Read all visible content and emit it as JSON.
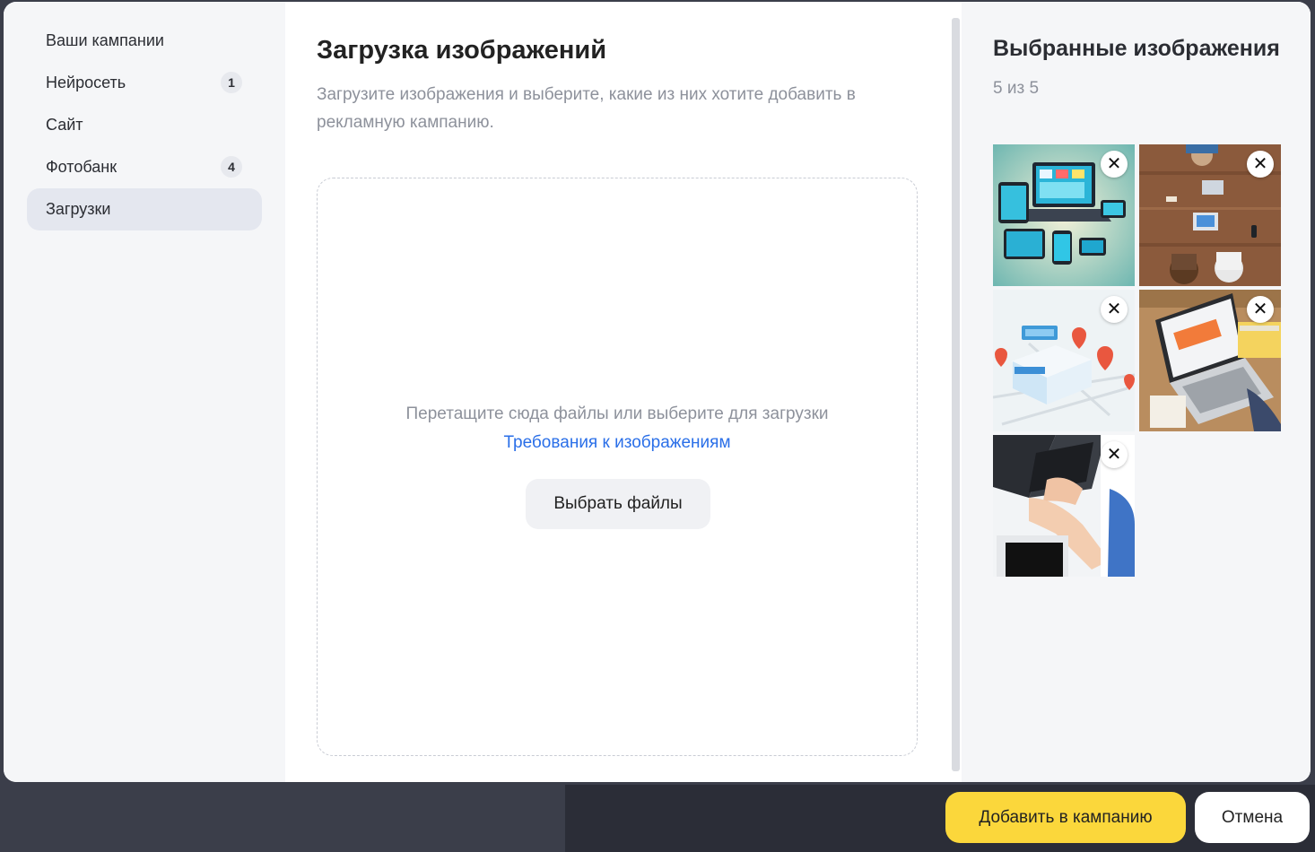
{
  "sidebar": {
    "items": [
      {
        "label": "Ваши кампании",
        "badge": null,
        "active": false
      },
      {
        "label": "Нейросеть",
        "badge": "1",
        "active": false
      },
      {
        "label": "Сайт",
        "badge": null,
        "active": false
      },
      {
        "label": "Фотобанк",
        "badge": "4",
        "active": false
      },
      {
        "label": "Загрузки",
        "badge": null,
        "active": true
      }
    ]
  },
  "main": {
    "title": "Загрузка изображений",
    "subtitle": "Загрузите изображения и выберите, какие из них хотите добавить в рекламную кампанию.",
    "dropzone": {
      "hint": "Перетащите сюда файлы или выберите для загрузки",
      "requirements_link": "Требования к изображениям",
      "choose_button": "Выбрать файлы"
    }
  },
  "selected": {
    "title": "Выбранные изображения",
    "count": "5 из 5",
    "images": [
      {
        "name": "devices-image",
        "remove_icon": "close-icon"
      },
      {
        "name": "office-table-image",
        "remove_icon": "close-icon"
      },
      {
        "name": "store-map-image",
        "remove_icon": "close-icon"
      },
      {
        "name": "laptop-desk-image",
        "remove_icon": "close-icon"
      },
      {
        "name": "typing-laptop-image",
        "remove_icon": "close-icon"
      }
    ],
    "remove_glyph": "✕"
  },
  "footer": {
    "add_label": "Добавить в кампанию",
    "cancel_label": "Отмена"
  },
  "colors": {
    "accent_yellow": "#fbd73b",
    "link_blue": "#2a6fe8",
    "sidebar_bg": "#f5f6f8",
    "active_item_bg": "#e4e7ef"
  }
}
